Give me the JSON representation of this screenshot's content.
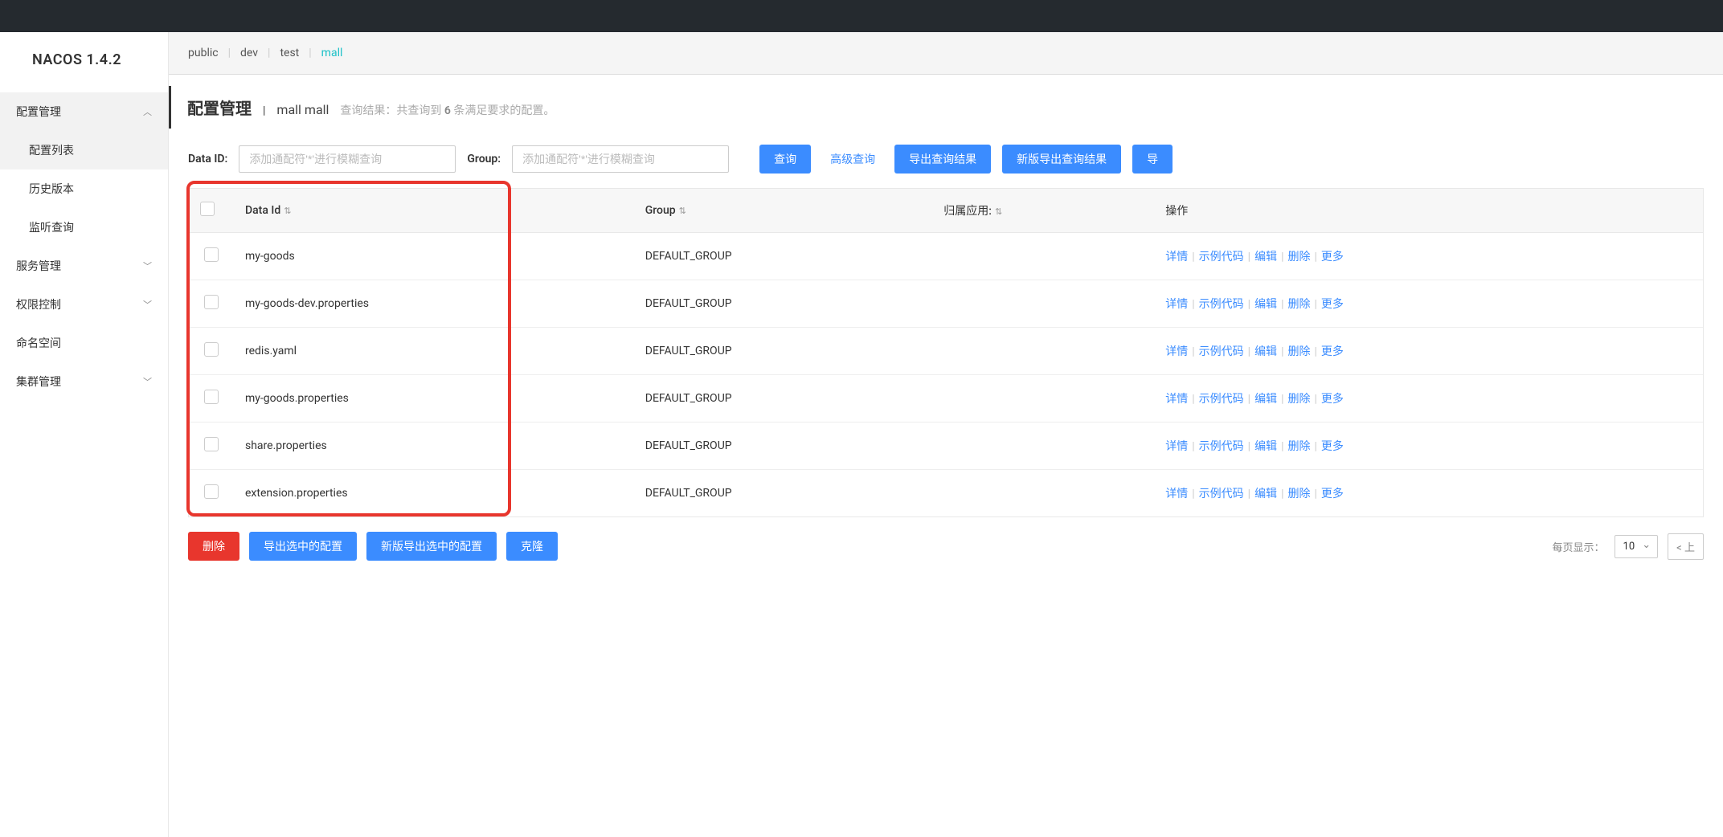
{
  "app": {
    "title": "NACOS 1.4.2"
  },
  "sidebar": {
    "items": [
      {
        "label": "配置管理",
        "expanded": true,
        "children": [
          {
            "label": "配置列表",
            "active": true
          },
          {
            "label": "历史版本"
          },
          {
            "label": "监听查询"
          }
        ]
      },
      {
        "label": "服务管理"
      },
      {
        "label": "权限控制"
      },
      {
        "label": "命名空间"
      },
      {
        "label": "集群管理"
      }
    ]
  },
  "tabs": [
    {
      "label": "public"
    },
    {
      "label": "dev"
    },
    {
      "label": "test"
    },
    {
      "label": "mall",
      "active": true
    }
  ],
  "header": {
    "title": "配置管理",
    "namespace": "mall  mall",
    "result_prefix": "查询结果：共查询到 ",
    "result_count": "6",
    "result_suffix": " 条满足要求的配置。"
  },
  "search": {
    "dataid_label": "Data ID:",
    "dataid_placeholder": "添加通配符'*'进行模糊查询",
    "group_label": "Group:",
    "group_placeholder": "添加通配符'*'进行模糊查询",
    "btn_query": "查询",
    "btn_advanced": "高级查询",
    "btn_export": "导出查询结果",
    "btn_export_new": "新版导出查询结果",
    "btn_import": "导"
  },
  "table": {
    "cols": {
      "dataid": "Data Id",
      "group": "Group",
      "app": "归属应用:",
      "op": "操作"
    },
    "ops": {
      "detail": "详情",
      "sample": "示例代码",
      "edit": "编辑",
      "delete": "删除",
      "more": "更多"
    },
    "rows": [
      {
        "dataid": "my-goods",
        "group": "DEFAULT_GROUP",
        "app": ""
      },
      {
        "dataid": "my-goods-dev.properties",
        "group": "DEFAULT_GROUP",
        "app": ""
      },
      {
        "dataid": "redis.yaml",
        "group": "DEFAULT_GROUP",
        "app": ""
      },
      {
        "dataid": "my-goods.properties",
        "group": "DEFAULT_GROUP",
        "app": ""
      },
      {
        "dataid": "share.properties",
        "group": "DEFAULT_GROUP",
        "app": ""
      },
      {
        "dataid": "extension.properties",
        "group": "DEFAULT_GROUP",
        "app": ""
      }
    ]
  },
  "footer": {
    "btn_delete": "删除",
    "btn_export_sel": "导出选中的配置",
    "btn_export_sel_new": "新版导出选中的配置",
    "btn_clone": "克隆",
    "page_size_label": "每页显示：",
    "page_size": "10",
    "prev": "< 上"
  }
}
